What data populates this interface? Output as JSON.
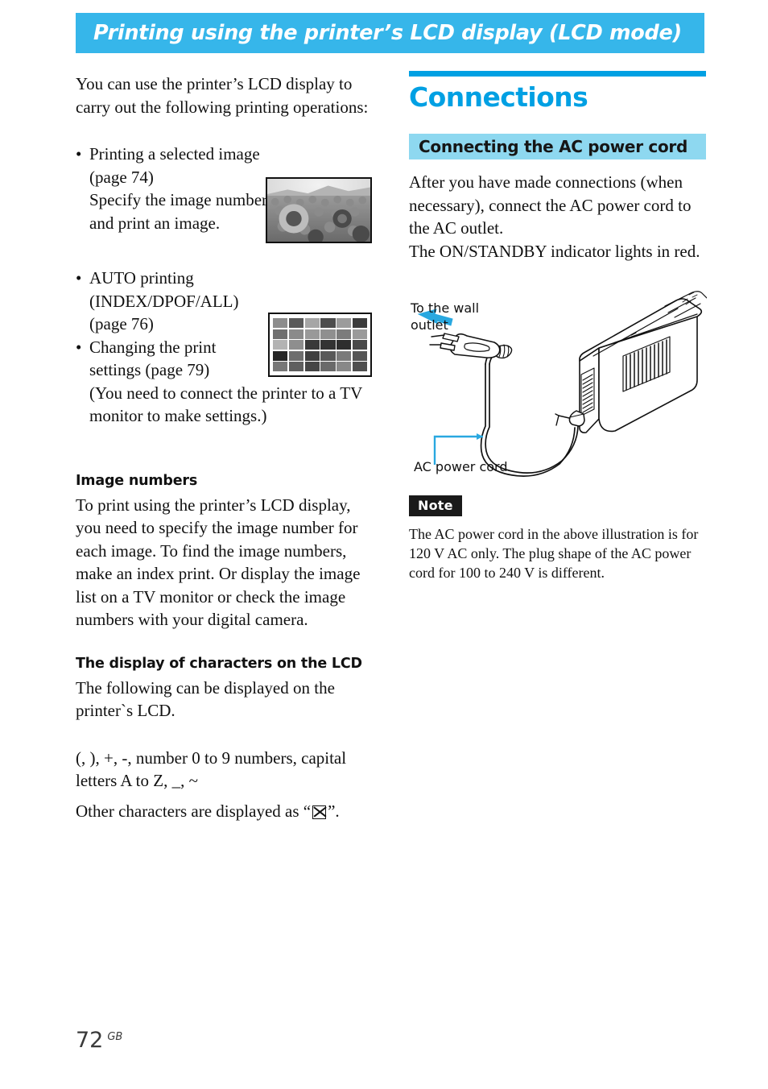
{
  "banner": {
    "title": "Printing using the printer’s LCD display  (LCD mode)",
    "bg_color": "#36b6ea"
  },
  "left_column": {
    "intro": "You can use the printer’s LCD display to carry out the following printing operations:",
    "bullets": [
      {
        "marker": "•",
        "text": "Printing a  selected image (page 74)",
        "continuation": "Specify the image number and print an image."
      },
      {
        "marker": "•",
        "text": "AUTO printing (INDEX/DPOF/ALL) (page 76)",
        "continuation": ""
      },
      {
        "marker": "•",
        "text": "Changing the print settings (page 79)",
        "continuation": "(You need to connect the printer to a TV monitor to make settings.)"
      }
    ],
    "thumbnails": {
      "sunflower_alt": "sunflower-field-photo",
      "index_alt": "index-print-thumbnail-grid",
      "index_rows": 5,
      "index_columns": 6
    },
    "section_image_numbers": {
      "heading": "Image numbers",
      "body": "To print using the printer’s LCD display, you need to specify the image number for each image.  To find the image numbers, make an index print. Or display the image list on a TV monitor or check the image numbers with your digital camera."
    },
    "section_characters": {
      "heading": "The display of characters on the LCD",
      "body": "The following can be displayed on the printer`s LCD.",
      "charset": " (, ), +, -, number 0 to 9 numbers, capital letters A to Z, _, ~",
      "other_prefix": "Other characters are displayed as “",
      "other_suffix": "”.",
      "glyph_name": "lcd-unknown-character-glyph"
    }
  },
  "right_column": {
    "chapter_title": "Connections",
    "chapter_title_color": "#00a0e3",
    "subhead": "Connecting the AC power cord",
    "subhead_bg_color": "#8ed8f0",
    "paragraph_1": "After you have made connections (when necessary), connect the AC power cord to the AC outlet.",
    "paragraph_2": "The ON/STANDBY indicator lights in red.",
    "illustration": {
      "name": "ac-power-cord-connection-illustration",
      "callout_wall_outlet": "To the wall\noutlet",
      "callout_wall_outlet_line1": "To the wall",
      "callout_wall_outlet_line2": "outlet",
      "callout_ac_power_cord": "AC power cord",
      "accent_color": "#29a8e0"
    },
    "note": {
      "badge": "Note",
      "badge_bg_color": "#1a1a1a",
      "body": "The AC power cord in the above illustration is for 120 V AC only.  The plug shape of the AC power cord for 100 to 240 V is different."
    }
  },
  "footer": {
    "page_number": "72",
    "region": "GB"
  }
}
